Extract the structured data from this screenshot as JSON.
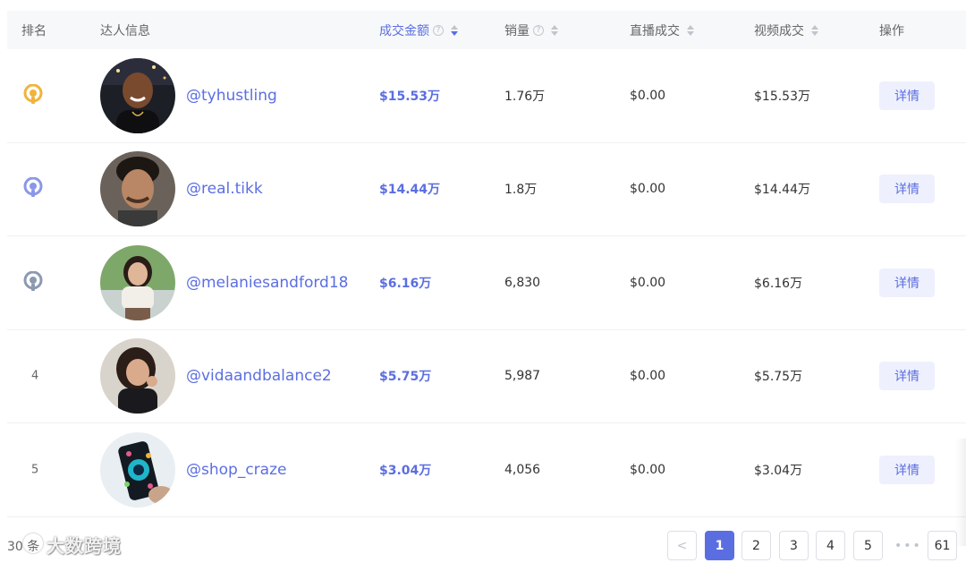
{
  "headers": {
    "rank": "排名",
    "creator": "达人信息",
    "amount": "成交金额",
    "sales": "销量",
    "live": "直播成交",
    "video": "视频成交",
    "action": "操作",
    "help_glyph": "?"
  },
  "rows": [
    {
      "rank": "1",
      "medal": "gold",
      "handle": "@tyhustling",
      "amount": "$15.53万",
      "sales": "1.76万",
      "live": "$0.00",
      "video": "$15.53万",
      "action": "详情"
    },
    {
      "rank": "2",
      "medal": "silver",
      "handle": "@real.tikk",
      "amount": "$14.44万",
      "sales": "1.8万",
      "live": "$0.00",
      "video": "$14.44万",
      "action": "详情"
    },
    {
      "rank": "3",
      "medal": "bronze",
      "handle": "@melaniesandford18",
      "amount": "$6.16万",
      "sales": "6,830",
      "live": "$0.00",
      "video": "$6.16万",
      "action": "详情"
    },
    {
      "rank": "4",
      "medal": "",
      "handle": "@vidaandbalance2",
      "amount": "$5.75万",
      "sales": "5,987",
      "live": "$0.00",
      "video": "$5.75万",
      "action": "详情"
    },
    {
      "rank": "5",
      "medal": "",
      "handle": "@shop_craze",
      "amount": "$3.04万",
      "sales": "4,056",
      "live": "$0.00",
      "video": "$3.04万",
      "action": "详情"
    }
  ],
  "footer": {
    "total_text": "30 条",
    "watermark": "大数跨境"
  },
  "pagination": {
    "prev": "<",
    "pages": [
      "1",
      "2",
      "3",
      "4",
      "5"
    ],
    "ellipsis": "•••",
    "last": "61",
    "current": "1"
  },
  "colors": {
    "accent": "#5b6ee1",
    "medal_gold": "#f0b43c",
    "medal_silver": "#8a97e8",
    "medal_bronze": "#8c9ab0"
  }
}
